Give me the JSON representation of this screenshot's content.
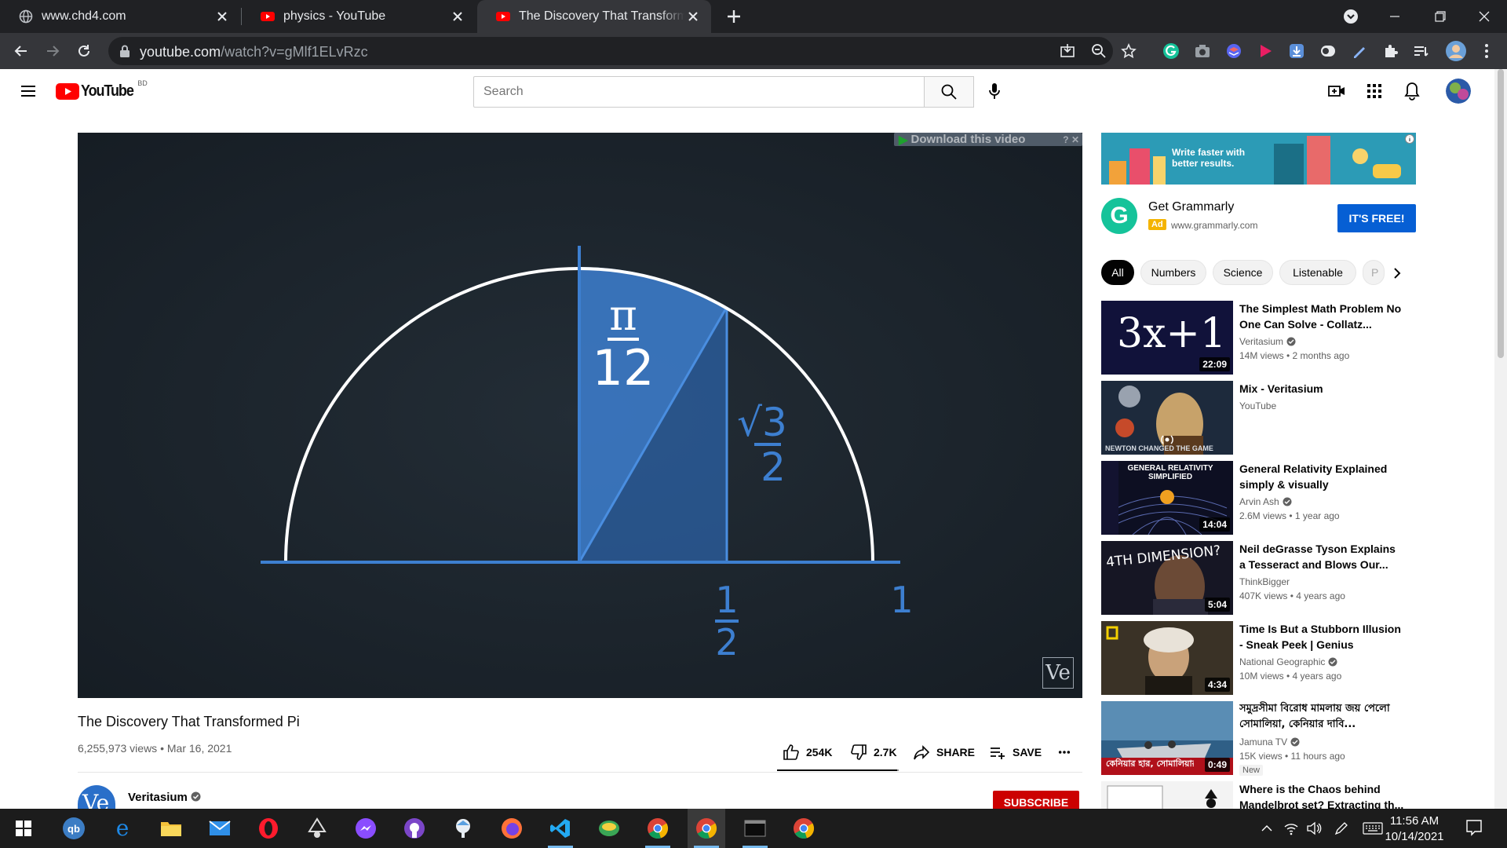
{
  "browser": {
    "tabs": [
      {
        "title": "www.chd4.com",
        "icon": "globe-icon"
      },
      {
        "title": "physics - YouTube",
        "icon": "youtube-icon"
      },
      {
        "title": "The Discovery That Transformed Pi - YouTube",
        "icon": "youtube-icon",
        "active": true
      }
    ],
    "url_host": "youtube.com",
    "url_path": "/watch?v=gMlf1ELvRzc"
  },
  "youtube": {
    "logo_text": "YouTube",
    "country_code": "BD",
    "search_placeholder": "Search"
  },
  "video": {
    "download_overlay": "Download this video",
    "overlay_buttons": "? ✕",
    "math": {
      "angle_numerator": "π",
      "angle_denominator": "12",
      "height_label": "√3",
      "height_denominator": "2",
      "x_numerator": "1",
      "x_denominator": "2",
      "radius_label": "1"
    },
    "watermark": "Ve",
    "title": "The Discovery That Transformed Pi",
    "views": "6,255,973 views",
    "date": "Mar 16, 2021",
    "likes": "254K",
    "dislikes": "2.7K",
    "like_ratio": 0.989,
    "share_label": "SHARE",
    "save_label": "SAVE",
    "channel": "Veritasium",
    "subscribe_label": "SUBSCRIBE"
  },
  "ad": {
    "banner_text": "Write faster with better results.",
    "title": "Get Grammarly",
    "badge": "Ad",
    "url": "www.grammarly.com",
    "cta": "IT'S FREE!"
  },
  "chips": [
    "All",
    "Numbers",
    "Science",
    "Listenable",
    "P"
  ],
  "recommendations": [
    {
      "title": "The Simplest Math Problem No One Can Solve - Collatz...",
      "channel": "Veritasium",
      "verified": true,
      "meta": "14M views • 2 months ago",
      "duration": "22:09",
      "thumb_text": "3x+1"
    },
    {
      "title": "Mix - Veritasium",
      "channel": "YouTube",
      "verified": false,
      "meta": "",
      "duration": "",
      "thumb_text": "NEWTON CHANGED THE GAME"
    },
    {
      "title": "General Relativity Explained simply & visually",
      "channel": "Arvin Ash",
      "verified": true,
      "meta": "2.6M views • 1 year ago",
      "duration": "14:04",
      "thumb_text": "GENERAL RELATIVITY SIMPLIFIED"
    },
    {
      "title": "Neil deGrasse Tyson Explains a Tesseract and Blows Our...",
      "channel": "ThinkBigger",
      "verified": false,
      "meta": "407K views • 4 years ago",
      "duration": "5:04",
      "thumb_text": "4TH DIMENSION?"
    },
    {
      "title": "Time Is But a Stubborn Illusion - Sneak Peek | Genius",
      "channel": "National Geographic",
      "verified": true,
      "meta": "10M views • 4 years ago",
      "duration": "4:34",
      "thumb_text": ""
    },
    {
      "title": "সমুদ্রসীমা বিরোধ মামলায় জয় পেলো সোমালিয়া, কেনিয়ার দাবি...",
      "channel": "Jamuna TV",
      "verified": true,
      "meta": "15K views • 11 hours ago",
      "duration": "0:49",
      "badge": "New",
      "thumb_text": "কেনিয়ার হার, সোমালিয়ার সমু"
    },
    {
      "title": "Where is the Chaos behind Mandelbrot set? Extracting th...",
      "channel": "",
      "verified": false,
      "meta": "",
      "duration": "",
      "thumb_text": ""
    }
  ],
  "taskbar": {
    "time": "11:56 AM",
    "date": "10/14/2021"
  },
  "colors": {
    "youtube_red": "#ff0000",
    "video_bg": "#1e272f",
    "math_blue": "#3d7fd0",
    "link_blue": "#065fd4",
    "grammarly_green": "#15c39a"
  }
}
